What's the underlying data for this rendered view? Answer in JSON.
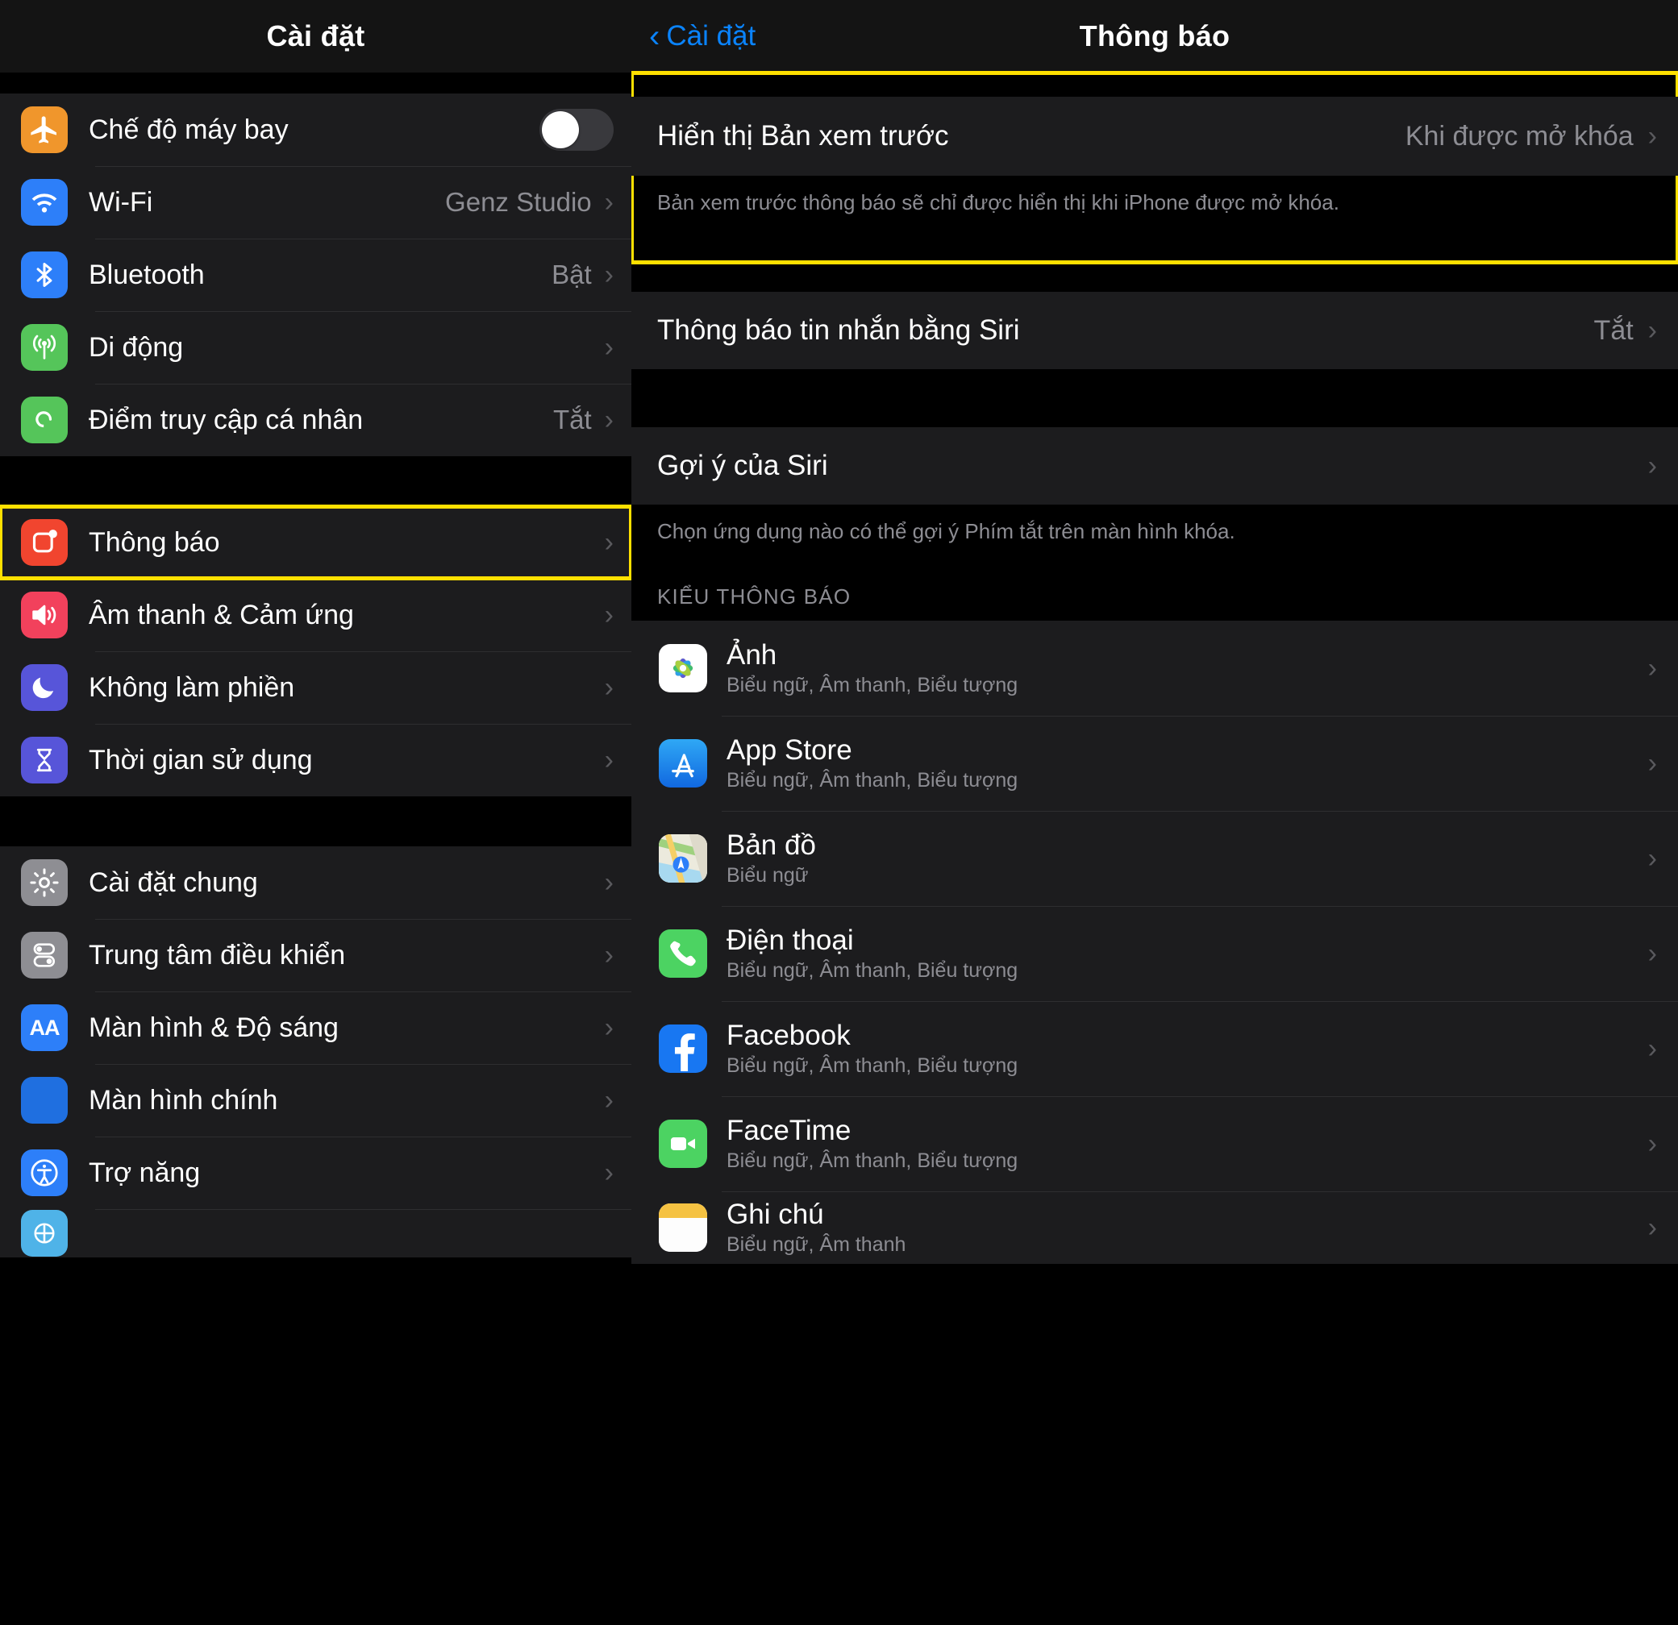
{
  "left": {
    "navbar": {
      "title": "Cài đặt"
    },
    "groups": [
      {
        "rows": [
          {
            "label": "Chế độ máy bay",
            "icon": "airplane-icon",
            "control": "toggle",
            "toggle_on": false
          },
          {
            "label": "Wi-Fi",
            "icon": "wifi-icon",
            "value": "Genz Studio",
            "control": "chevron"
          },
          {
            "label": "Bluetooth",
            "icon": "bluetooth-icon",
            "value": "Bật",
            "control": "chevron"
          },
          {
            "label": "Di động",
            "icon": "cellular-icon",
            "value": "",
            "control": "chevron"
          },
          {
            "label": "Điểm truy cập cá nhân",
            "icon": "hotspot-icon",
            "value": "Tắt",
            "control": "chevron"
          }
        ]
      },
      {
        "rows": [
          {
            "label": "Thông báo",
            "icon": "notifications-icon",
            "value": "",
            "control": "chevron",
            "highlight": true
          },
          {
            "label": "Âm thanh & Cảm ứng",
            "icon": "sounds-icon",
            "value": "",
            "control": "chevron"
          },
          {
            "label": "Không làm phiền",
            "icon": "dnd-icon",
            "value": "",
            "control": "chevron"
          },
          {
            "label": "Thời gian sử dụng",
            "icon": "screentime-icon",
            "value": "",
            "control": "chevron"
          }
        ]
      },
      {
        "rows": [
          {
            "label": "Cài đặt chung",
            "icon": "gear-icon",
            "value": "",
            "control": "chevron"
          },
          {
            "label": "Trung tâm điều khiển",
            "icon": "control-center-icon",
            "value": "",
            "control": "chevron"
          },
          {
            "label": "Màn hình & Độ sáng",
            "icon": "display-brightness-icon",
            "value": "",
            "control": "chevron"
          },
          {
            "label": "Màn hình chính",
            "icon": "home-screen-icon",
            "value": "",
            "control": "chevron"
          },
          {
            "label": "Trợ năng",
            "icon": "accessibility-icon",
            "value": "",
            "control": "chevron"
          },
          {
            "label": "",
            "icon": "wallpaper-icon",
            "value": "",
            "control": "chevron"
          }
        ]
      }
    ]
  },
  "right": {
    "navbar": {
      "back_label": "Cài đặt",
      "title": "Thông báo"
    },
    "preview_row": {
      "label": "Hiển thị Bản xem trước",
      "value": "Khi được mở khóa"
    },
    "preview_footnote": "Bản xem trước thông báo sẽ chỉ được hiển thị khi iPhone được mở khóa.",
    "siri_announce_row": {
      "label": "Thông báo tin nhắn bằng Siri",
      "value": "Tắt"
    },
    "siri_suggestions_row": {
      "label": "Gợi ý của Siri",
      "value": ""
    },
    "siri_footnote": "Chọn ứng dụng nào có thể gợi ý Phím tắt trên màn hình khóa.",
    "style_header": "KIỂU THÔNG BÁO",
    "apps": [
      {
        "name": "Ảnh",
        "sub": "Biểu ngữ, Âm thanh, Biểu tượng",
        "icon": "photos-icon"
      },
      {
        "name": "App Store",
        "sub": "Biểu ngữ, Âm thanh, Biểu tượng",
        "icon": "app-store-icon"
      },
      {
        "name": "Bản đồ",
        "sub": "Biểu ngữ",
        "icon": "maps-icon"
      },
      {
        "name": "Điện thoại",
        "sub": "Biểu ngữ, Âm thanh, Biểu tượng",
        "icon": "phone-icon"
      },
      {
        "name": "Facebook",
        "sub": "Biểu ngữ, Âm thanh, Biểu tượng",
        "icon": "facebook-icon"
      },
      {
        "name": "FaceTime",
        "sub": "Biểu ngữ, Âm thanh, Biểu tượng",
        "icon": "facetime-icon"
      },
      {
        "name": "Ghi chú",
        "sub": "Biểu ngữ, Âm thanh",
        "icon": "notes-icon"
      }
    ]
  },
  "colors": {
    "highlight": "#ffe000",
    "accent_blue": "#0a84ff",
    "group_bg": "#1c1c1e",
    "secondary_text": "#8d8d93"
  }
}
